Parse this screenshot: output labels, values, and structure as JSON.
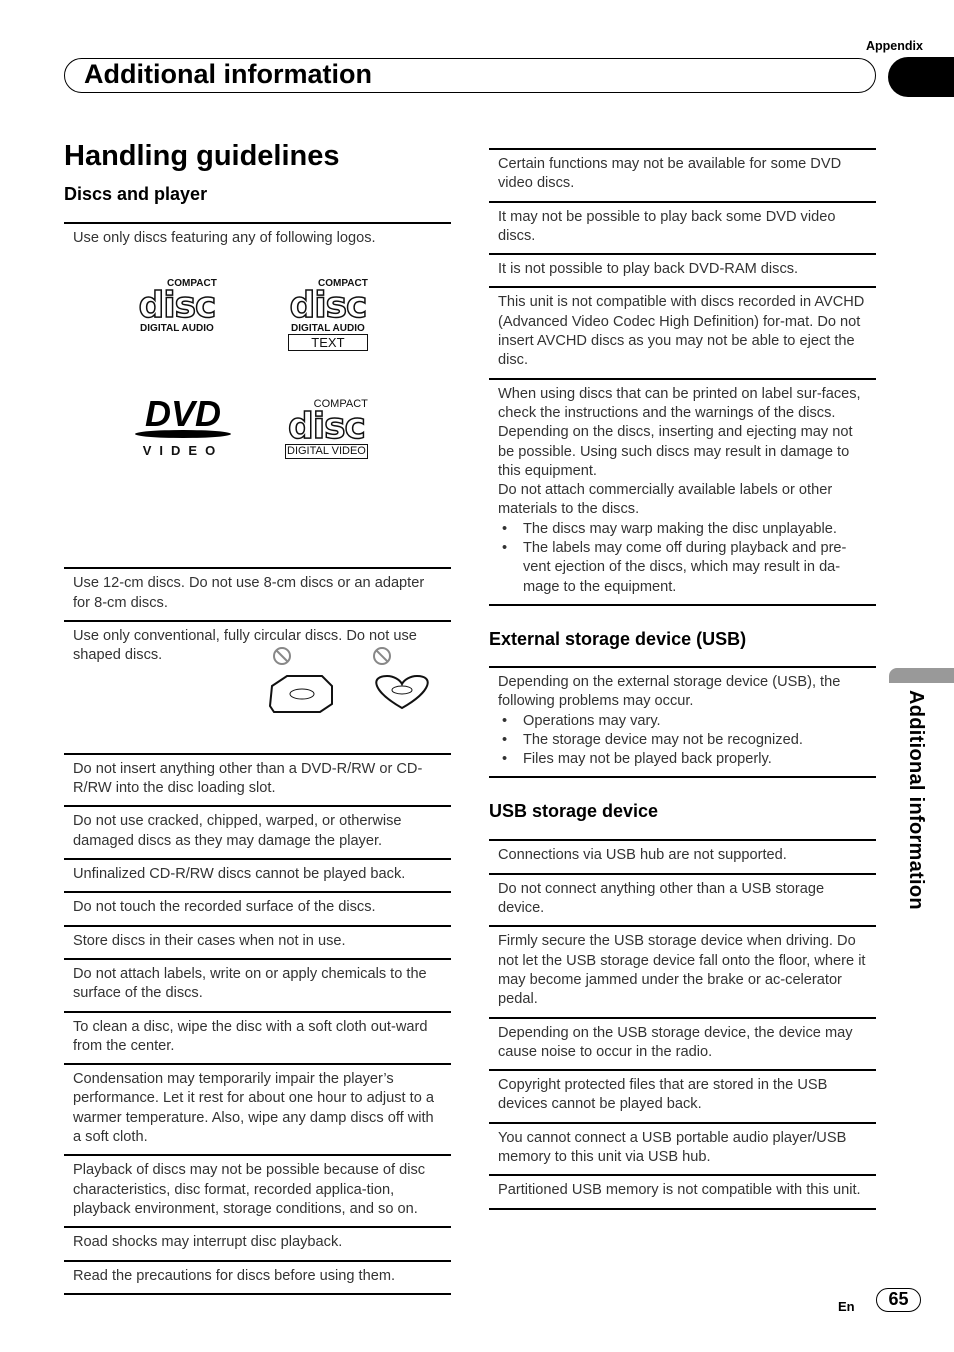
{
  "header": {
    "section": "Appendix",
    "title": "Additional information",
    "side_tab": "Additional information"
  },
  "page": {
    "title": "Handling guidelines",
    "lang": "En",
    "number": "65"
  },
  "left": {
    "heading": "Discs and player",
    "intro": "Use only discs featuring any of following logos.",
    "logos": [
      {
        "top": "COMPACT",
        "main": "disc",
        "bottom": "DIGITAL AUDIO"
      },
      {
        "top": "COMPACT",
        "main": "disc",
        "bottom": "DIGITAL AUDIO",
        "extra": "TEXT"
      },
      {
        "main": "DVD",
        "bottom": "VIDEO"
      },
      {
        "top": "COMPACT",
        "main": "disc",
        "bottom": "DIGITAL VIDEO"
      }
    ],
    "rows": [
      "Use 12-cm discs. Do not use 8-cm discs or an adapter for 8-cm discs.",
      "Use only conventional, fully circular discs. Do not use shaped discs.",
      "Do not insert anything other than a DVD-R/RW or CD-R/RW into the disc loading slot.",
      "Do not use cracked, chipped, warped, or otherwise damaged discs as they may damage the player.",
      "Unfinalized CD-R/RW discs cannot be played back.",
      "Do not touch the recorded surface of the discs.",
      "Store discs in their cases when not in use.",
      "Do not attach labels, write on or apply chemicals to the surface of the discs.",
      "To clean a disc, wipe the disc with a soft cloth out-ward from the center.",
      "Condensation may temporarily impair the player’s performance. Let it rest for about one hour to adjust to a warmer temperature. Also, wipe any damp discs off with a soft cloth.",
      "Playback of discs may not be possible because of disc characteristics, disc format, recorded applica-tion, playback environment, storage conditions, and so on.",
      "Road shocks may interrupt disc playback.",
      "Read the precautions for discs before using them."
    ]
  },
  "right": {
    "rows": [
      "Certain functions may not be available for some DVD video discs.",
      "It may not be possible to play back some DVD video discs.",
      "It is not possible to play back DVD-RAM discs.",
      "This unit is not compatible with discs recorded in AVCHD (Advanced Video Codec High Definition) for-mat. Do not insert AVCHD discs as you may not be able to eject the disc."
    ],
    "label_row": {
      "text": "When using discs that can be printed on label sur-faces, check the instructions and the warnings of the discs. Depending on the discs, inserting and ejecting may not be possible. Using such discs may result in damage to this equipment.",
      "text2": "Do not attach commercially available labels or other materials to the discs.",
      "bullets": [
        "The discs may warp making the disc unplayable.",
        "The labels may come off during playback and pre-vent ejection of the discs, which may result in da-mage to the equipment."
      ]
    },
    "ext_heading": "External storage device (USB)",
    "ext_row": {
      "text": "Depending on the external storage device (USB), the following problems may occur.",
      "bullets": [
        "Operations may vary.",
        "The storage device may not be recognized.",
        "Files may not be played back properly."
      ]
    },
    "usb_heading": "USB storage device",
    "usb_rows": [
      "Connections via USB hub are not supported.",
      "Do not connect anything other than a USB storage device.",
      "Firmly secure the USB storage device when driving. Do not let the USB storage device fall onto the floor, where it may become jammed under the brake or ac-celerator pedal.",
      "Depending on the USB storage device, the device may cause noise to occur in the radio.",
      "Copyright protected files that are stored in the USB devices cannot be played back.",
      "You cannot connect a USB portable audio player/USB memory to this unit via USB hub.",
      "Partitioned USB memory is not compatible with this unit."
    ]
  }
}
